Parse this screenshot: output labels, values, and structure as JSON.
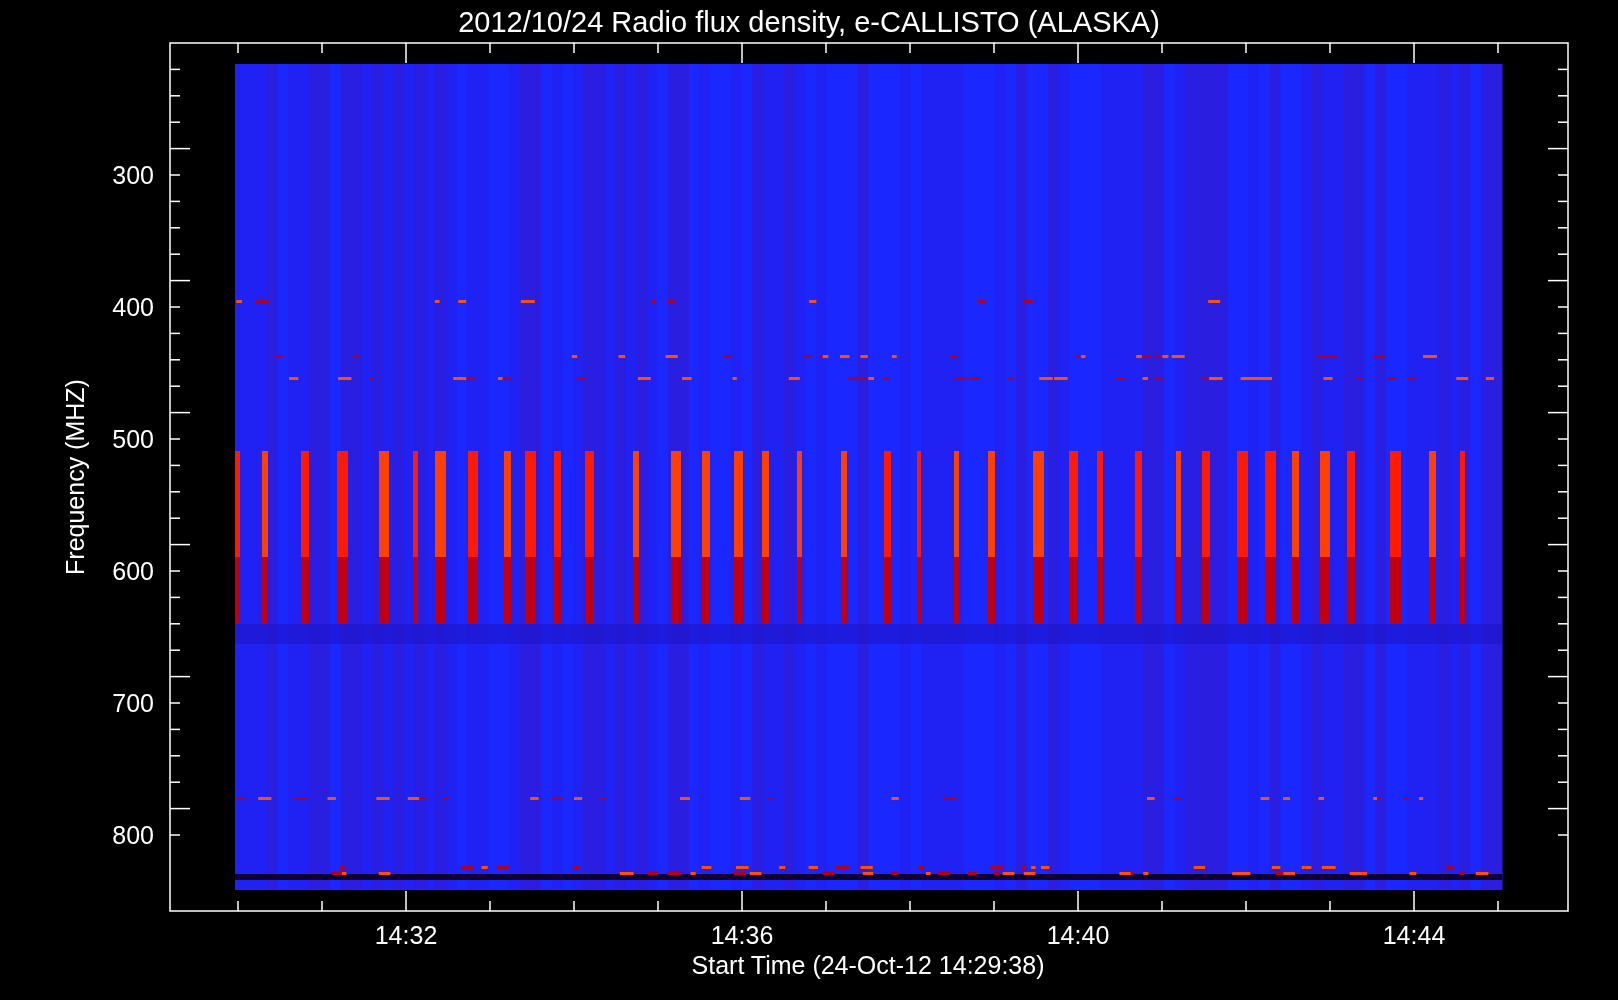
{
  "title": "2012/10/24  Radio flux density, e-CALLISTO (ALASKA)",
  "y_axis": {
    "label": "Frequency (MHZ)",
    "ticks": [
      "300",
      "400",
      "500",
      "600",
      "700",
      "800"
    ]
  },
  "x_axis": {
    "label": "Start Time (24-Oct-12 14:29:38)",
    "ticks": [
      "14:32",
      "14:36",
      "14:40",
      "14:44"
    ]
  }
}
